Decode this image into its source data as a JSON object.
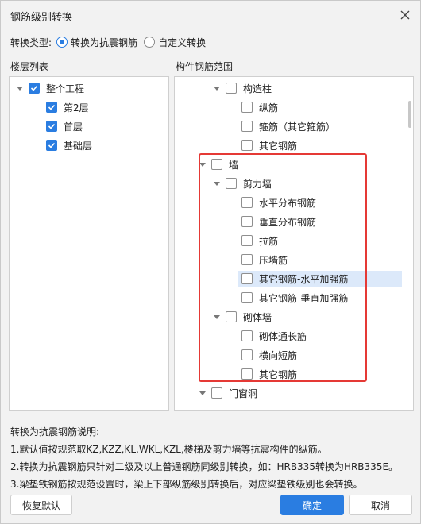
{
  "dialog": {
    "title": "钢筋级别转换"
  },
  "conversion": {
    "label": "转换类型:",
    "options": [
      {
        "label": "转换为抗震钢筋",
        "selected": true
      },
      {
        "label": "自定义转换",
        "selected": false
      }
    ]
  },
  "floor_list": {
    "title": "楼层列表",
    "items": [
      {
        "label": "整个工程",
        "checked": true
      },
      {
        "label": "第2层",
        "checked": true
      },
      {
        "label": "首层",
        "checked": true
      },
      {
        "label": "基础层",
        "checked": true
      }
    ]
  },
  "component_range": {
    "title": "构件钢筋范围",
    "items": [
      {
        "label": "构造柱",
        "checked": false
      },
      {
        "label": "纵筋",
        "checked": false
      },
      {
        "label": "箍筋（其它箍筋）",
        "checked": false
      },
      {
        "label": "其它钢筋",
        "checked": false
      },
      {
        "label": "墙",
        "checked": false
      },
      {
        "label": "剪力墙",
        "checked": false
      },
      {
        "label": "水平分布钢筋",
        "checked": false
      },
      {
        "label": "垂直分布钢筋",
        "checked": false
      },
      {
        "label": "拉筋",
        "checked": false
      },
      {
        "label": "压墙筋",
        "checked": false
      },
      {
        "label": "其它钢筋-水平加强筋",
        "checked": false
      },
      {
        "label": "其它钢筋-垂直加强筋",
        "checked": false
      },
      {
        "label": "砌体墙",
        "checked": false
      },
      {
        "label": "砌体通长筋",
        "checked": false
      },
      {
        "label": "横向短筋",
        "checked": false
      },
      {
        "label": "其它钢筋",
        "checked": false
      },
      {
        "label": "门窗洞",
        "checked": false
      }
    ]
  },
  "notes": {
    "title": "转换为抗震钢筋说明:",
    "lines": [
      "1.默认值按规范取KZ,KZZ,KL,WKL,KZL,楼梯及剪力墙等抗震构件的纵筋。",
      "2.转换为抗震钢筋只针对二级及以上普通钢筋同级别转换，如：HRB335转换为HRB335E。",
      "3.梁垫铁钢筋按规范设置时，梁上下部纵筋级别转换后，对应梁垫铁级别也会转换。"
    ]
  },
  "buttons": {
    "restore_default": "恢复默认",
    "confirm": "确定",
    "cancel": "取消"
  },
  "colors": {
    "accent": "#2a7de1",
    "highlight_box": "#e53935",
    "selected_row": "#dce9fa"
  }
}
